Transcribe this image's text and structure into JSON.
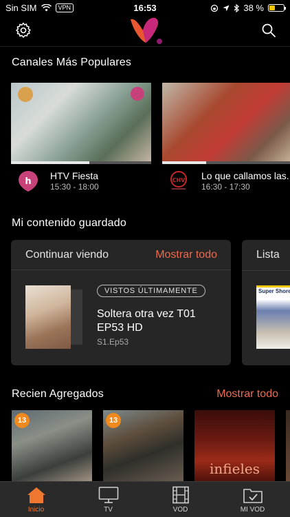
{
  "status_bar": {
    "carrier": "Sin SIM",
    "vpn": "VPN",
    "time": "16:53",
    "battery": "38 %",
    "battery_level": 0.38
  },
  "header": {
    "settings_icon": "gear-icon",
    "search_icon": "search-icon",
    "logo_colors": [
      "#e8572f",
      "#c8287a",
      "#8d1a6e"
    ]
  },
  "popular": {
    "title": "Canales Más Populares",
    "channels": [
      {
        "name": "HTV Fiesta",
        "time": "15:30 - 18:00",
        "progress": 0.56,
        "logo_color": "#c8427a"
      },
      {
        "name": "Lo que callamos las...",
        "time": "16:30 - 17:30",
        "progress": 0.32,
        "logo_color": "#c62828"
      }
    ]
  },
  "saved": {
    "title": "Mi contenido guardado",
    "continue": {
      "title": "Continuar viendo",
      "more": "Mostrar todo",
      "badge": "VISTOS ÚLTIMAMENTE",
      "episode_title": "Soltera otra vez T01 EP53 HD",
      "episode_sub": "S1.Ep53"
    },
    "list": {
      "title": "Lista",
      "poster_text": "Super Shore"
    }
  },
  "recent": {
    "title": "Recien Agregados",
    "more": "Mostrar todo",
    "items": [
      {
        "badge": "13"
      },
      {
        "badge": "13"
      },
      {
        "title": "infieles"
      },
      {}
    ]
  },
  "tabs": [
    {
      "label": "Inicio",
      "icon": "home-icon",
      "active": true
    },
    {
      "label": "TV",
      "icon": "tv-icon",
      "active": false
    },
    {
      "label": "VOD",
      "icon": "film-icon",
      "active": false
    },
    {
      "label": "MI VOD",
      "icon": "folder-check-icon",
      "active": false
    }
  ],
  "colors": {
    "accent": "#ec6a4f",
    "active_tab": "#f0772f",
    "card_bg": "#262626",
    "tabbar_bg": "#2a2a2a"
  }
}
